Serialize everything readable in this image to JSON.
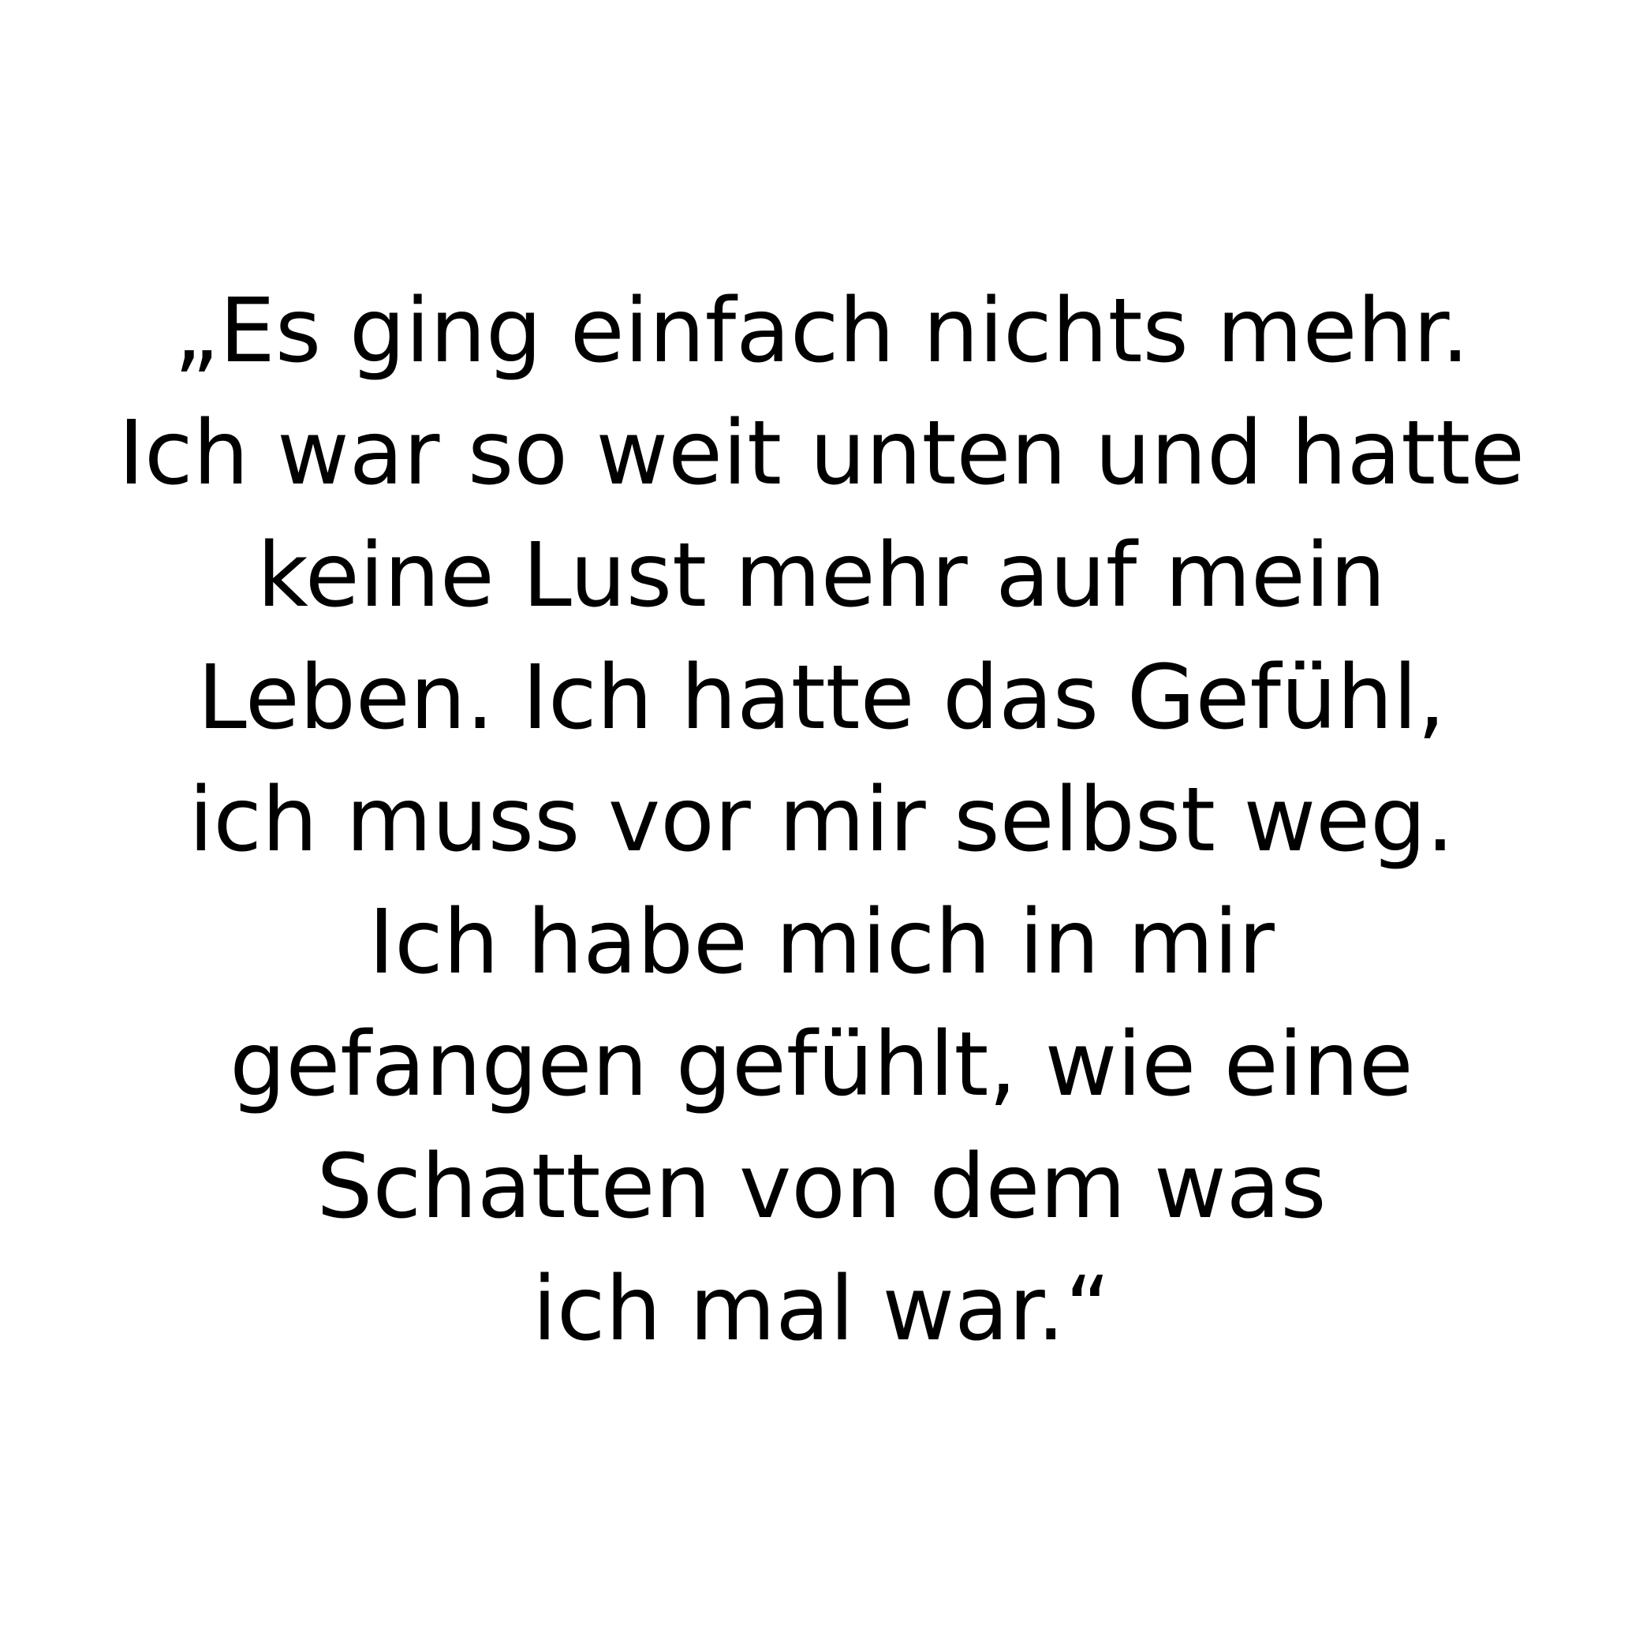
{
  "quote": {
    "lines": [
      "„Es ging einfach nichts mehr.",
      "Ich war so weit unten und hatte",
      "keine Lust mehr auf mein",
      "Leben. Ich hatte das Gefühl,",
      "ich muss vor mir selbst weg.",
      "Ich habe mich in mir",
      "gefangen gefühlt, wie eine",
      "Schatten von dem was",
      "ich mal war.“"
    ]
  },
  "colors": {
    "background": "#ffffff",
    "text": "#000000"
  }
}
